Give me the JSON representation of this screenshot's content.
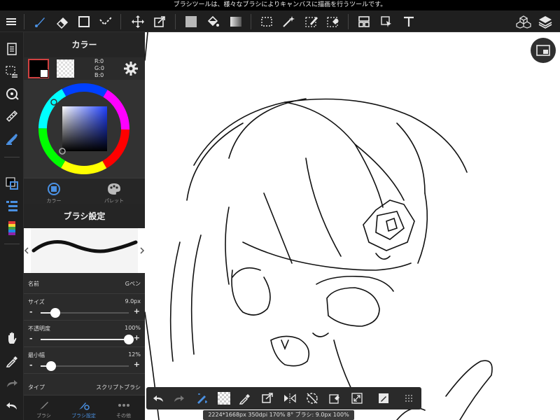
{
  "status_bar": {
    "message": "ブラシツールは、様々なブラシによりキャンバスに描画を行うツールです。"
  },
  "toolbar": {
    "icons": [
      "menu-icon",
      "brush-icon",
      "eraser-icon",
      "rectangle-icon",
      "dot-icon",
      "move-icon",
      "transform-icon",
      "fill-color-icon",
      "bucket-icon",
      "gradient-icon",
      "select-rect-icon",
      "magic-wand-icon",
      "select-pen-icon",
      "select-eraser-icon",
      "frame-icon",
      "operation-icon",
      "text-icon",
      "3d-icon",
      "layers-icon"
    ]
  },
  "color_panel": {
    "title": "カラー",
    "rgb_r": "R:0",
    "rgb_g": "G:0",
    "rgb_b": "B:0",
    "foreground": "#000000",
    "tab_color": "カラー",
    "tab_palette": "パレット"
  },
  "brush_panel": {
    "title": "ブラシ設定",
    "name_label": "名前",
    "name_value": "Gペン",
    "size_label": "サイズ",
    "size_value": "9.0px",
    "size_fraction": 0.17,
    "opacity_label": "不透明度",
    "opacity_value": "100%",
    "opacity_fraction": 1.0,
    "min_width_label": "最小幅",
    "min_width_value": "12%",
    "min_width_fraction": 0.12,
    "type_label": "タイプ",
    "type_value": "スクリプトブラシ"
  },
  "bottom_tabs": {
    "brush": "ブラシ",
    "brush_settings": "ブラシ設定",
    "other": "その他"
  },
  "info_bar": {
    "text": "2224*1668px 350dpi 170% 8° ブラシ: 9.0px 100%"
  },
  "colors": {
    "accent": "#4a90e2",
    "panel": "#2b2b2b",
    "toolbar": "#1f1f1f"
  }
}
